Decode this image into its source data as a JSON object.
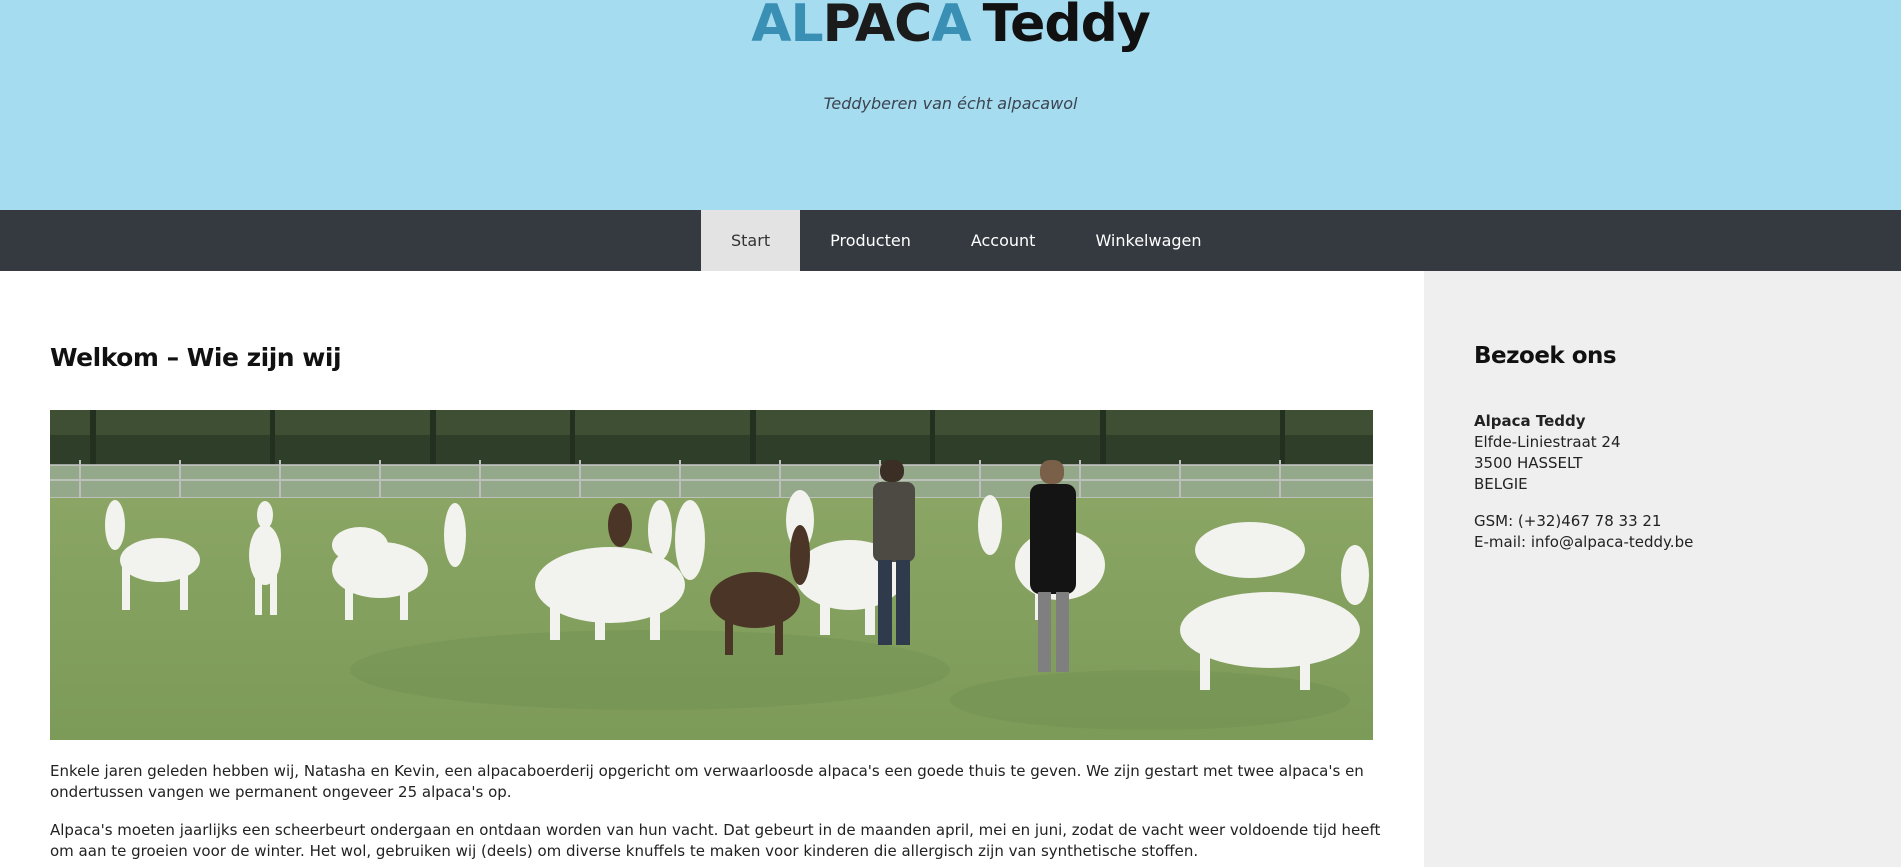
{
  "header": {
    "logo_part1": "AL",
    "logo_part2": "PAC",
    "logo_part3": "A",
    "logo_part4": "Teddy",
    "tagline": "Teddyberen van écht alpacawol"
  },
  "nav": {
    "items": [
      {
        "label": "Start"
      },
      {
        "label": "Producten"
      },
      {
        "label": "Account"
      },
      {
        "label": "Winkelwagen"
      }
    ]
  },
  "main": {
    "title": "Welkom – Wie zijn wij",
    "paragraphs": [
      "Enkele jaren geleden hebben wij, Natasha en Kevin, een alpacaboerderij opgericht om verwaarloosde alpaca's een goede thuis te geven. We zijn gestart met twee alpaca's en ondertussen vangen we permanent ongeveer 25 alpaca's op.",
      "Alpaca's moeten jaarlijks een scheerbeurt ondergaan en ontdaan worden van hun vacht. Dat gebeurt in de maanden april, mei en juni, zodat de vacht weer voldoende tijd heeft om aan te groeien voor de winter. Het wol, gebruiken wij (deels) om diverse knuffels te maken voor kinderen die allergisch zijn van synthetische stoffen."
    ]
  },
  "sidebar": {
    "title": "Bezoek ons",
    "name": "Alpaca Teddy",
    "street": "Elfde-Liniestraat 24",
    "city": "3500 HASSELT",
    "country": "BELGIE",
    "phone": "GSM: (+32)467 78 33 21",
    "email": "E-mail: info@alpaca-teddy.be"
  },
  "colors": {
    "header_bg": "#a6dcef",
    "nav_bg": "#343a40",
    "nav_active_bg": "#e3e3e3",
    "sidebar_bg": "#efefef",
    "logo_accent": "#3a8fb4"
  }
}
